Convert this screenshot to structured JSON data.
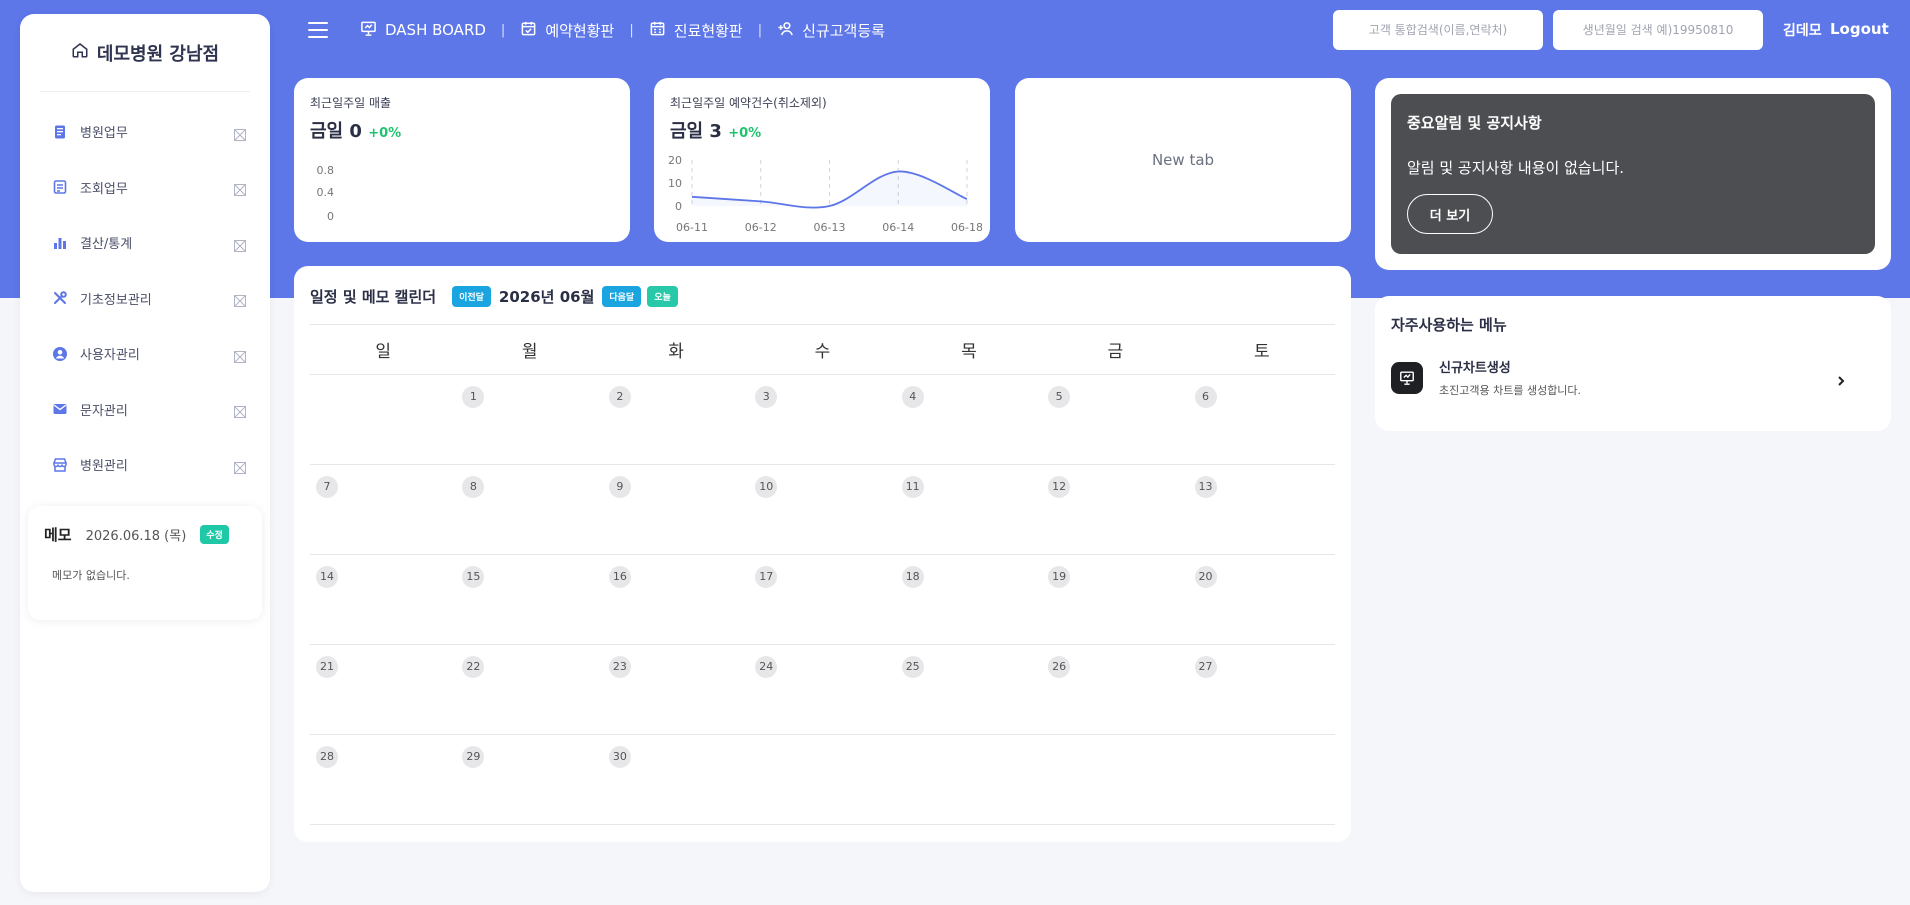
{
  "brand": {
    "name": "데모병원 강남점"
  },
  "sidebar": {
    "items": [
      {
        "label": "병원업무",
        "icon": "document-icon"
      },
      {
        "label": "조회업무",
        "icon": "list-icon"
      },
      {
        "label": "결산/통계",
        "icon": "bar-chart-icon"
      },
      {
        "label": "기초정보관리",
        "icon": "tools-icon"
      },
      {
        "label": "사용자관리",
        "icon": "user-circle-icon"
      },
      {
        "label": "문자관리",
        "icon": "envelope-icon"
      },
      {
        "label": "병원관리",
        "icon": "store-icon"
      }
    ]
  },
  "memo": {
    "title": "메모",
    "date": "2026.06.18 (목)",
    "edit_label": "수정",
    "content": "메모가 없습니다."
  },
  "nav": {
    "items": [
      {
        "label": "DASH BOARD",
        "icon": "presentation-icon"
      },
      {
        "label": "예약현황판",
        "icon": "calendar-check-icon"
      },
      {
        "label": "진료현황판",
        "icon": "calendar-grid-icon"
      },
      {
        "label": "신규고객등록",
        "icon": "user-plus-icon"
      }
    ],
    "separator": "|"
  },
  "search": {
    "customer_placeholder": "고객 통합검색(이름,연락처)",
    "birth_placeholder": "생년월일 검색 예)19950810"
  },
  "user": {
    "name": "김데모",
    "logout_label": "Logout"
  },
  "stats": [
    {
      "label": "최근일주일 매출",
      "value": "금일 0",
      "change": "+0%"
    },
    {
      "label": "최근일주일 예약건수(취소제외)",
      "value": "금일 3",
      "change": "+0%"
    }
  ],
  "chart_data": [
    {
      "type": "line",
      "x": [],
      "values": [],
      "yticks": [
        "0.8",
        "0.4",
        "0"
      ]
    },
    {
      "type": "line",
      "x": [
        "06-11",
        "06-12",
        "06-13",
        "06-14",
        "06-18"
      ],
      "values": [
        4,
        2,
        0,
        15,
        3
      ],
      "yticks": [
        "20",
        "10",
        "0"
      ],
      "ylim": [
        0,
        20
      ],
      "color": "#5d76e8"
    }
  ],
  "newtab": {
    "label": "New tab"
  },
  "notice": {
    "title": "중요알림 및 공지사항",
    "body": "알림 및 공지사항 내용이 없습니다.",
    "more_label": "더 보기"
  },
  "freq": {
    "title": "자주사용하는 메뉴",
    "items": [
      {
        "name": "신규차트생성",
        "desc": "초진고객용 차트를 생성합니다.",
        "icon": "presentation-icon"
      }
    ]
  },
  "calendar": {
    "title": "일정 및 메모 캘린더",
    "prev_label": "이전달",
    "month": "2026년 06월",
    "next_label": "다음달",
    "today_label": "오늘",
    "weekdays": [
      "일",
      "월",
      "화",
      "수",
      "목",
      "금",
      "토"
    ],
    "weeks": [
      [
        "",
        "1",
        "2",
        "3",
        "4",
        "5",
        "6"
      ],
      [
        "7",
        "8",
        "9",
        "10",
        "11",
        "12",
        "13"
      ],
      [
        "14",
        "15",
        "16",
        "17",
        "18",
        "19",
        "20"
      ],
      [
        "21",
        "22",
        "23",
        "24",
        "25",
        "26",
        "27"
      ],
      [
        "28",
        "29",
        "30",
        "",
        "",
        "",
        ""
      ]
    ]
  }
}
